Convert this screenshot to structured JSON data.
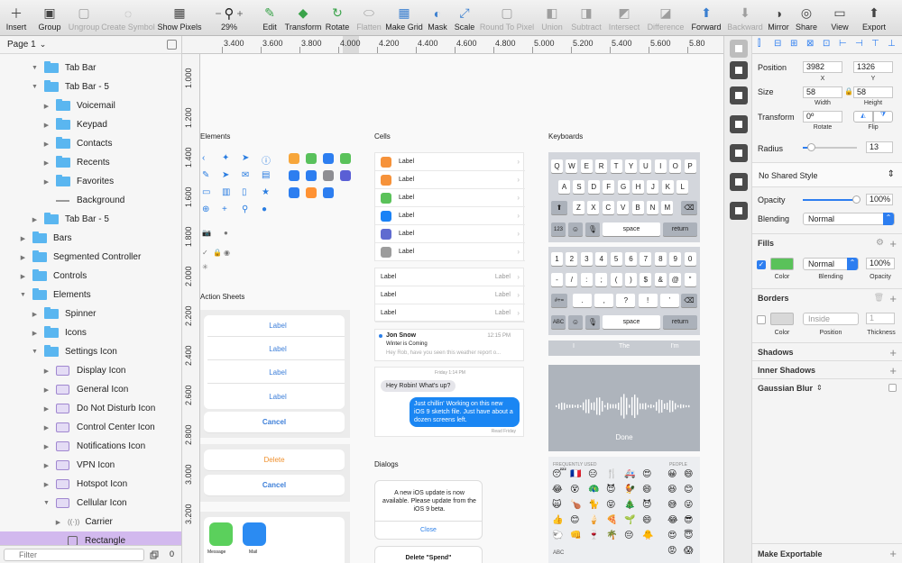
{
  "toolbar": {
    "items": [
      {
        "label": "Insert",
        "icon": "plus-icon"
      },
      {
        "label": "Group",
        "icon": "group-icon"
      },
      {
        "label": "Ungroup",
        "icon": "ungroup-icon"
      },
      {
        "label": "Create Symbol",
        "icon": "symbol-icon"
      },
      {
        "label": "Show Pixels",
        "icon": "pixels-icon"
      },
      {
        "label": "29%",
        "icon": "zoom-icon"
      },
      {
        "label": "Edit",
        "icon": "edit-icon"
      },
      {
        "label": "Transform",
        "icon": "transform-icon"
      },
      {
        "label": "Rotate",
        "icon": "rotate-icon"
      },
      {
        "label": "Flatten",
        "icon": "flatten-icon"
      },
      {
        "label": "Make Grid",
        "icon": "grid-icon"
      },
      {
        "label": "Mask",
        "icon": "mask-icon"
      },
      {
        "label": "Scale",
        "icon": "scale-icon"
      },
      {
        "label": "Round To Pixel",
        "icon": "round-pixel-icon"
      },
      {
        "label": "Union",
        "icon": "union-icon"
      },
      {
        "label": "Subtract",
        "icon": "subtract-icon"
      },
      {
        "label": "Intersect",
        "icon": "intersect-icon"
      },
      {
        "label": "Difference",
        "icon": "difference-icon"
      },
      {
        "label": "Forward",
        "icon": "forward-icon"
      },
      {
        "label": "Backward",
        "icon": "backward-icon"
      },
      {
        "label": "Mirror",
        "icon": "mirror-icon"
      },
      {
        "label": "Share",
        "icon": "share-icon"
      },
      {
        "label": "View",
        "icon": "view-icon"
      },
      {
        "label": "Export",
        "icon": "export-icon"
      }
    ],
    "zoom_minus": "−",
    "zoom_plus": "+"
  },
  "layers": {
    "page_label": "Page 1",
    "page_chevron": "⌄",
    "filter_placeholder": "Filter",
    "filter_count": "0",
    "rows": [
      {
        "label": "Tab Bar",
        "kind": "folder",
        "depth": 3,
        "expanded": true
      },
      {
        "label": "Tab Bar - 5",
        "kind": "folder",
        "depth": 3,
        "expanded": true
      },
      {
        "label": "Voicemail",
        "kind": "folder",
        "depth": 4,
        "expanded": false
      },
      {
        "label": "Keypad",
        "kind": "folder",
        "depth": 4,
        "expanded": false
      },
      {
        "label": "Contacts",
        "kind": "folder",
        "depth": 4,
        "expanded": false
      },
      {
        "label": "Recents",
        "kind": "folder",
        "depth": 4,
        "expanded": false
      },
      {
        "label": "Favorites",
        "kind": "folder",
        "depth": 4,
        "expanded": false
      },
      {
        "label": "Background",
        "kind": "line",
        "depth": 4,
        "expanded": null
      },
      {
        "label": "Tab Bar - 5",
        "kind": "folder",
        "depth": 3,
        "expanded": false
      },
      {
        "label": "Bars",
        "kind": "folder",
        "depth": 2,
        "expanded": false
      },
      {
        "label": "Segmented Controller",
        "kind": "folder",
        "depth": 2,
        "expanded": false
      },
      {
        "label": "Controls",
        "kind": "folder",
        "depth": 2,
        "expanded": false
      },
      {
        "label": "Elements",
        "kind": "folder",
        "depth": 2,
        "expanded": true
      },
      {
        "label": "Spinner",
        "kind": "folder",
        "depth": 3,
        "expanded": false
      },
      {
        "label": "Icons",
        "kind": "folder",
        "depth": 3,
        "expanded": false
      },
      {
        "label": "Settings Icon",
        "kind": "folder",
        "depth": 3,
        "expanded": true
      },
      {
        "label": "Display Icon",
        "kind": "symbol",
        "depth": 4,
        "expanded": false
      },
      {
        "label": "General Icon",
        "kind": "symbol",
        "depth": 4,
        "expanded": false
      },
      {
        "label": "Do Not Disturb Icon",
        "kind": "symbol",
        "depth": 4,
        "expanded": false
      },
      {
        "label": "Control Center Icon",
        "kind": "symbol",
        "depth": 4,
        "expanded": false
      },
      {
        "label": "Notifications Icon",
        "kind": "symbol",
        "depth": 4,
        "expanded": false
      },
      {
        "label": "VPN Icon",
        "kind": "symbol",
        "depth": 4,
        "expanded": false
      },
      {
        "label": "Hotspot Icon",
        "kind": "symbol",
        "depth": 4,
        "expanded": false
      },
      {
        "label": "Cellular Icon",
        "kind": "symbol",
        "depth": 4,
        "expanded": true
      },
      {
        "label": "Carrier",
        "kind": "carrier",
        "depth": 5,
        "expanded": false
      },
      {
        "label": "Rectangle",
        "kind": "rect",
        "depth": 5,
        "expanded": null,
        "selected": true
      }
    ]
  },
  "ruler": {
    "h_labels": [
      "3.400",
      "3.600",
      "3.800",
      "4.000",
      "4.200",
      "4.400",
      "4.600",
      "4.800",
      "5.000",
      "5.200",
      "5.400",
      "5.600",
      "5.80"
    ],
    "v_labels": [
      "1.000",
      "1.200",
      "1.400",
      "1.600",
      "1.800",
      "2.000",
      "2.200",
      "2.400",
      "2.600",
      "2.800",
      "3.000",
      "3.200"
    ]
  },
  "canvas": {
    "elements_title": "Elements",
    "cells_title": "Cells",
    "keyboards_title": "Keyboards",
    "action_sheets_title": "Action Sheets",
    "dialogs_title": "Dialogs",
    "cells": [
      {
        "label": "Label",
        "color": "#f6923a"
      },
      {
        "label": "Label",
        "color": "#f6923a"
      },
      {
        "label": "Label",
        "color": "#5bc25a"
      },
      {
        "label": "Label",
        "color": "#1a82f6"
      },
      {
        "label": "Label",
        "color": "#5f6bd0"
      },
      {
        "label": "Label",
        "color": "#9c9c9c"
      }
    ],
    "cells2": [
      {
        "label": "Label",
        "right": "Label"
      },
      {
        "label": "Label",
        "right": "Label"
      },
      {
        "label": "Label",
        "right": "Label"
      }
    ],
    "message": {
      "sender": "Jon Snow",
      "time": "12:15 PM",
      "subject": "Winter is Coming",
      "preview": "Hey Rob, have you seen this weather report o..."
    },
    "chat": {
      "time": "Friday 1:14 PM",
      "received": "Hey Robin! What's up?",
      "sent": "Just chillin' Working on this new iOS 9 sketch file. Just have about a dozen screens left.",
      "status": "Read Friday"
    },
    "action_sheet": [
      "Label",
      "Label",
      "Label",
      "Label"
    ],
    "action_cancel": "Cancel",
    "action_delete": "Delete",
    "action_cancel2": "Cancel",
    "share_items": [
      "Message",
      "Mail"
    ],
    "dialog1": {
      "text": "A new iOS update is now available. Please update from the iOS 9 beta.",
      "button": "Close"
    },
    "dialog2": {
      "text": "Delete \"Spend\""
    },
    "kb1": {
      "row1": [
        "Q",
        "W",
        "E",
        "R",
        "T",
        "Y",
        "U",
        "I",
        "O",
        "P"
      ],
      "row2": [
        "A",
        "S",
        "D",
        "F",
        "G",
        "H",
        "J",
        "K",
        "L"
      ],
      "row3": [
        "Z",
        "X",
        "C",
        "V",
        "B",
        "N",
        "M"
      ],
      "shift": "⬆",
      "backspace": "⌫",
      "num": "123",
      "emoji": "☺",
      "mic": "🎙",
      "space": "space",
      "return": "return"
    },
    "kb2": {
      "row1": [
        "1",
        "2",
        "3",
        "4",
        "5",
        "6",
        "7",
        "8",
        "9",
        "0"
      ],
      "row2": [
        "-",
        "/",
        ":",
        ";",
        "(",
        ")",
        "$",
        "&",
        "@",
        "\""
      ],
      "row3": [
        ".",
        ",",
        "?",
        "!",
        "’"
      ],
      "sym": "#+=",
      "backspace": "⌫",
      "abc": "ABC",
      "emoji": "☺",
      "mic": "🎙",
      "space": "space",
      "return": "return"
    },
    "suggestions": [
      "I",
      "The",
      "I'm"
    ],
    "dictation_done": "Done",
    "emoji_sections": [
      "FREQUENTLY USED",
      "PEOPLE"
    ],
    "emoji_abc": "ABC",
    "emoji_freq": [
      "😴",
      "🇫🇷",
      "😑",
      "🍴",
      "🚑",
      "😍",
      "😂",
      "😵",
      "🦚",
      "😈",
      "🐓",
      "😄",
      "🙀",
      "🍗",
      "🐈",
      "😝",
      "🎄",
      "😈",
      "👍",
      "😊",
      "🍦",
      "🍕",
      "🌱",
      "😄",
      "🐑",
      "👊",
      "🍷",
      "🌴",
      "😔",
      "🐥"
    ],
    "emoji_people": [
      "😀",
      "😄",
      "😆",
      "😊",
      "😅",
      "😜",
      "😂",
      "😎",
      "😍",
      "😇",
      "😡",
      "😱"
    ]
  },
  "inspector": {
    "position_label": "Position",
    "position_x": "3982",
    "position_y": "1326",
    "x_sub": "X",
    "y_sub": "Y",
    "size_label": "Size",
    "width": "58",
    "height": "58",
    "width_sub": "Width",
    "height_sub": "Height",
    "transform_label": "Transform",
    "rotate_value": "0º",
    "rotate_sub": "Rotate",
    "flip_sub": "Flip",
    "radius_label": "Radius",
    "radius_value": "13",
    "radius_fraction": 0.15,
    "shared_style": "No Shared Style",
    "opacity_label": "Opacity",
    "opacity_value": "100%",
    "opacity_fraction": 1.0,
    "blending_label": "Blending",
    "blending_value": "Normal",
    "fills_label": "Fills",
    "fill_color": "#5ac25a",
    "fill_blend": "Normal",
    "fill_opacity": "100%",
    "fill_color_sub": "Color",
    "fill_blend_sub": "Blending",
    "fill_opacity_sub": "Opacity",
    "borders_label": "Borders",
    "border_color": "#d8d8d8",
    "border_position": "Inside",
    "border_thickness": "1",
    "border_color_sub": "Color",
    "border_position_sub": "Position",
    "border_thickness_sub": "Thickness",
    "shadows_label": "Shadows",
    "inner_shadows_label": "Inner Shadows",
    "gaussian_blur_label": "Gaussian Blur",
    "make_exportable_label": "Make Exportable",
    "accent": "#2d7ef0"
  }
}
